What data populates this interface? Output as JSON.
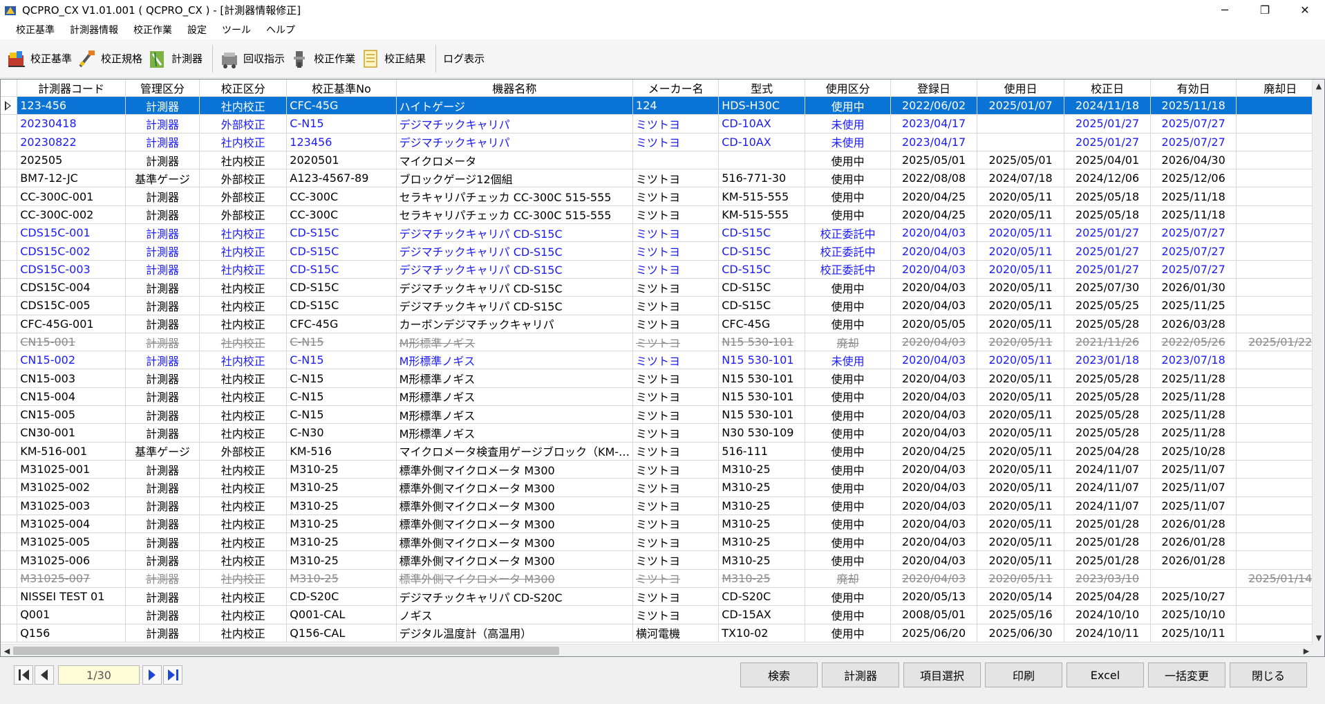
{
  "window": {
    "title": "QCPRO_CX V1.01.001 ( QCPRO_CX ) - [計測器情報修正]",
    "minimize": "─",
    "restore": "❐",
    "close": "✕"
  },
  "menu": [
    "校正基準",
    "計測器情報",
    "校正作業",
    "設定",
    "ツール",
    "ヘルプ"
  ],
  "toolbar": {
    "group1": [
      {
        "label": "校正基準",
        "icon": "calibration-standard-icon"
      },
      {
        "label": "校正規格",
        "icon": "calibration-spec-icon"
      },
      {
        "label": "計測器",
        "icon": "instrument-icon"
      }
    ],
    "group2": [
      {
        "label": "回収指示",
        "icon": "collection-instruction-icon"
      },
      {
        "label": "校正作業",
        "icon": "calibration-work-icon"
      },
      {
        "label": "校正結果",
        "icon": "calibration-result-icon"
      }
    ],
    "log": "ログ表示"
  },
  "table": {
    "columns": [
      "計測器コード",
      "管理区分",
      "校正区分",
      "校正基準No",
      "機器名称",
      "メーカー名",
      "型式",
      "使用区分",
      "登録日",
      "使用日",
      "校正日",
      "有効日",
      "廃却日"
    ],
    "rows": [
      {
        "state": "sel",
        "cells": [
          "123-456",
          "計測器",
          "社内校正",
          "CFC-45G",
          "ハイトゲージ",
          "124",
          "HDS-H30C",
          "使用中",
          "2022/06/02",
          "2025/01/07",
          "2024/11/18",
          "2025/11/18",
          ""
        ]
      },
      {
        "state": "blue",
        "cells": [
          "20230418",
          "計測器",
          "外部校正",
          "C-N15",
          "デジマチックキャリパ",
          "ミツトヨ",
          "CD-10AX",
          "未使用",
          "2023/04/17",
          "",
          "2025/01/27",
          "2025/07/27",
          ""
        ]
      },
      {
        "state": "blue",
        "cells": [
          "20230822",
          "計測器",
          "社内校正",
          "123456",
          "デジマチックキャリパ",
          "ミツトヨ",
          "CD-10AX",
          "未使用",
          "2023/04/17",
          "",
          "2025/01/27",
          "2025/07/27",
          ""
        ]
      },
      {
        "state": "",
        "cells": [
          "202505",
          "計測器",
          "社内校正",
          "2020501",
          "マイクロメータ",
          "",
          "",
          "使用中",
          "2025/05/01",
          "2025/05/01",
          "2025/04/01",
          "2026/04/30",
          ""
        ]
      },
      {
        "state": "",
        "cells": [
          "BM7-12-JC",
          "基準ゲージ",
          "外部校正",
          "A123-4567-89",
          "ブロックゲージ12個組",
          "ミツトヨ",
          "516-771-30",
          "使用中",
          "2022/08/08",
          "2024/07/18",
          "2024/12/06",
          "2025/12/06",
          ""
        ]
      },
      {
        "state": "",
        "cells": [
          "CC-300C-001",
          "計測器",
          "外部校正",
          "CC-300C",
          "セラキャリパチェッカ CC-300C 515-555",
          "ミツトヨ",
          "KM-515-555",
          "使用中",
          "2020/04/25",
          "2020/05/11",
          "2025/05/18",
          "2025/11/18",
          ""
        ]
      },
      {
        "state": "",
        "cells": [
          "CC-300C-002",
          "計測器",
          "外部校正",
          "CC-300C",
          "セラキャリパチェッカ CC-300C 515-555",
          "ミツトヨ",
          "KM-515-555",
          "使用中",
          "2020/04/25",
          "2020/05/11",
          "2025/05/18",
          "2025/11/18",
          ""
        ]
      },
      {
        "state": "blue",
        "cells": [
          "CDS15C-001",
          "計測器",
          "社内校正",
          "CD-S15C",
          "デジマチックキャリパ CD-S15C",
          "ミツトヨ",
          "CD-S15C",
          "校正委託中",
          "2020/04/03",
          "2020/05/11",
          "2025/01/27",
          "2025/07/27",
          ""
        ]
      },
      {
        "state": "blue",
        "cells": [
          "CDS15C-002",
          "計測器",
          "社内校正",
          "CD-S15C",
          "デジマチックキャリパ CD-S15C",
          "ミツトヨ",
          "CD-S15C",
          "校正委託中",
          "2020/04/03",
          "2020/05/11",
          "2025/01/27",
          "2025/07/27",
          ""
        ]
      },
      {
        "state": "blue",
        "cells": [
          "CDS15C-003",
          "計測器",
          "社内校正",
          "CD-S15C",
          "デジマチックキャリパ CD-S15C",
          "ミツトヨ",
          "CD-S15C",
          "校正委託中",
          "2020/04/03",
          "2020/05/11",
          "2025/01/27",
          "2025/07/27",
          ""
        ]
      },
      {
        "state": "",
        "cells": [
          "CDS15C-004",
          "計測器",
          "社内校正",
          "CD-S15C",
          "デジマチックキャリパ CD-S15C",
          "ミツトヨ",
          "CD-S15C",
          "使用中",
          "2020/04/03",
          "2020/05/11",
          "2025/07/30",
          "2026/01/30",
          ""
        ]
      },
      {
        "state": "",
        "cells": [
          "CDS15C-005",
          "計測器",
          "社内校正",
          "CD-S15C",
          "デジマチックキャリパ CD-S15C",
          "ミツトヨ",
          "CD-S15C",
          "使用中",
          "2020/04/03",
          "2020/05/11",
          "2025/05/25",
          "2025/11/25",
          ""
        ]
      },
      {
        "state": "",
        "cells": [
          "CFC-45G-001",
          "計測器",
          "社内校正",
          "CFC-45G",
          "カーボンデジマチックキャリパ",
          "ミツトヨ",
          "CFC-45G",
          "使用中",
          "2020/05/05",
          "2020/05/11",
          "2025/05/28",
          "2026/03/28",
          ""
        ]
      },
      {
        "state": "disc",
        "cells": [
          "CN15-001",
          "計測器",
          "社内校正",
          "C-N15",
          "M形標準ノギス",
          "ミツトヨ",
          "N15 530-101",
          "廃却",
          "2020/04/03",
          "2020/05/11",
          "2021/11/26",
          "2022/05/26",
          "2025/01/22"
        ]
      },
      {
        "state": "blue",
        "cells": [
          "CN15-002",
          "計測器",
          "社内校正",
          "C-N15",
          "M形標準ノギス",
          "ミツトヨ",
          "N15 530-101",
          "未使用",
          "2020/04/03",
          "2020/05/11",
          "2023/01/18",
          "2023/07/18",
          ""
        ]
      },
      {
        "state": "",
        "cells": [
          "CN15-003",
          "計測器",
          "社内校正",
          "C-N15",
          "M形標準ノギス",
          "ミツトヨ",
          "N15 530-101",
          "使用中",
          "2020/04/03",
          "2020/05/11",
          "2025/05/28",
          "2025/11/28",
          ""
        ]
      },
      {
        "state": "",
        "cells": [
          "CN15-004",
          "計測器",
          "社内校正",
          "C-N15",
          "M形標準ノギス",
          "ミツトヨ",
          "N15 530-101",
          "使用中",
          "2020/04/03",
          "2020/05/11",
          "2025/05/28",
          "2025/11/28",
          ""
        ]
      },
      {
        "state": "",
        "cells": [
          "CN15-005",
          "計測器",
          "社内校正",
          "C-N15",
          "M形標準ノギス",
          "ミツトヨ",
          "N15 530-101",
          "使用中",
          "2020/04/03",
          "2020/05/11",
          "2025/05/28",
          "2025/11/28",
          ""
        ]
      },
      {
        "state": "",
        "cells": [
          "CN30-001",
          "計測器",
          "社内校正",
          "C-N30",
          "M形標準ノギス",
          "ミツトヨ",
          "N30 530-109",
          "使用中",
          "2020/04/03",
          "2020/05/11",
          "2025/05/28",
          "2025/11/28",
          ""
        ]
      },
      {
        "state": "",
        "cells": [
          "KM-516-001",
          "基準ゲージ",
          "外部校正",
          "KM-516",
          "マイクロメータ検査用ゲージブロック（KM-…",
          "ミツトヨ",
          "516-111",
          "使用中",
          "2020/04/25",
          "2020/05/11",
          "2025/04/28",
          "2025/10/28",
          ""
        ]
      },
      {
        "state": "",
        "cells": [
          "M31025-001",
          "計測器",
          "社内校正",
          "M310-25",
          "標準外側マイクロメータ M300",
          "ミツトヨ",
          "M310-25",
          "使用中",
          "2020/04/03",
          "2020/05/11",
          "2024/11/07",
          "2025/11/07",
          ""
        ]
      },
      {
        "state": "",
        "cells": [
          "M31025-002",
          "計測器",
          "社内校正",
          "M310-25",
          "標準外側マイクロメータ M300",
          "ミツトヨ",
          "M310-25",
          "使用中",
          "2020/04/03",
          "2020/05/11",
          "2024/11/07",
          "2025/11/07",
          ""
        ]
      },
      {
        "state": "",
        "cells": [
          "M31025-003",
          "計測器",
          "社内校正",
          "M310-25",
          "標準外側マイクロメータ M300",
          "ミツトヨ",
          "M310-25",
          "使用中",
          "2020/04/03",
          "2020/05/11",
          "2024/11/07",
          "2025/11/07",
          ""
        ]
      },
      {
        "state": "",
        "cells": [
          "M31025-004",
          "計測器",
          "社内校正",
          "M310-25",
          "標準外側マイクロメータ M300",
          "ミツトヨ",
          "M310-25",
          "使用中",
          "2020/04/03",
          "2020/05/11",
          "2025/01/28",
          "2026/01/28",
          ""
        ]
      },
      {
        "state": "",
        "cells": [
          "M31025-005",
          "計測器",
          "社内校正",
          "M310-25",
          "標準外側マイクロメータ M300",
          "ミツトヨ",
          "M310-25",
          "使用中",
          "2020/04/03",
          "2020/05/11",
          "2025/01/28",
          "2026/01/28",
          ""
        ]
      },
      {
        "state": "",
        "cells": [
          "M31025-006",
          "計測器",
          "社内校正",
          "M310-25",
          "標準外側マイクロメータ M300",
          "ミツトヨ",
          "M310-25",
          "使用中",
          "2020/04/03",
          "2020/05/11",
          "2025/01/28",
          "2026/01/28",
          ""
        ]
      },
      {
        "state": "disc",
        "cells": [
          "M31025-007",
          "計測器",
          "社内校正",
          "M310-25",
          "標準外側マイクロメータ M300",
          "ミツトヨ",
          "M310-25",
          "廃却",
          "2020/04/03",
          "2020/05/11",
          "2023/03/10",
          "",
          "2025/01/14"
        ]
      },
      {
        "state": "",
        "cells": [
          "NISSEI TEST 01",
          "計測器",
          "社内校正",
          "CD-S20C",
          "デジマチックキャリパ CD-S20C",
          "ミツトヨ",
          "CD-S20C",
          "使用中",
          "2020/05/13",
          "2020/05/14",
          "2025/04/28",
          "2025/10/27",
          ""
        ]
      },
      {
        "state": "",
        "cells": [
          "Q001",
          "計測器",
          "社内校正",
          "Q001-CAL",
          "ノギス",
          "ミツトヨ",
          "CD-15AX",
          "使用中",
          "2008/05/01",
          "2025/05/16",
          "2024/10/10",
          "2025/10/10",
          ""
        ]
      },
      {
        "state": "",
        "cells": [
          "Q156",
          "計測器",
          "社内校正",
          "Q156-CAL",
          "デジタル温度計（高温用）",
          "横河電機",
          "TX10-02",
          "使用中",
          "2025/06/20",
          "2025/06/30",
          "2024/10/11",
          "2025/10/11",
          ""
        ]
      }
    ]
  },
  "pager": {
    "value": "1/30"
  },
  "actions": [
    "検索",
    "計測器",
    "項目選択",
    "印刷",
    "Excel",
    "一括変更",
    "閉じる"
  ],
  "colors": {
    "selection": "#0a74d6",
    "blue_text": "#1a1aff",
    "discarded_text": "#8a8a8a"
  }
}
